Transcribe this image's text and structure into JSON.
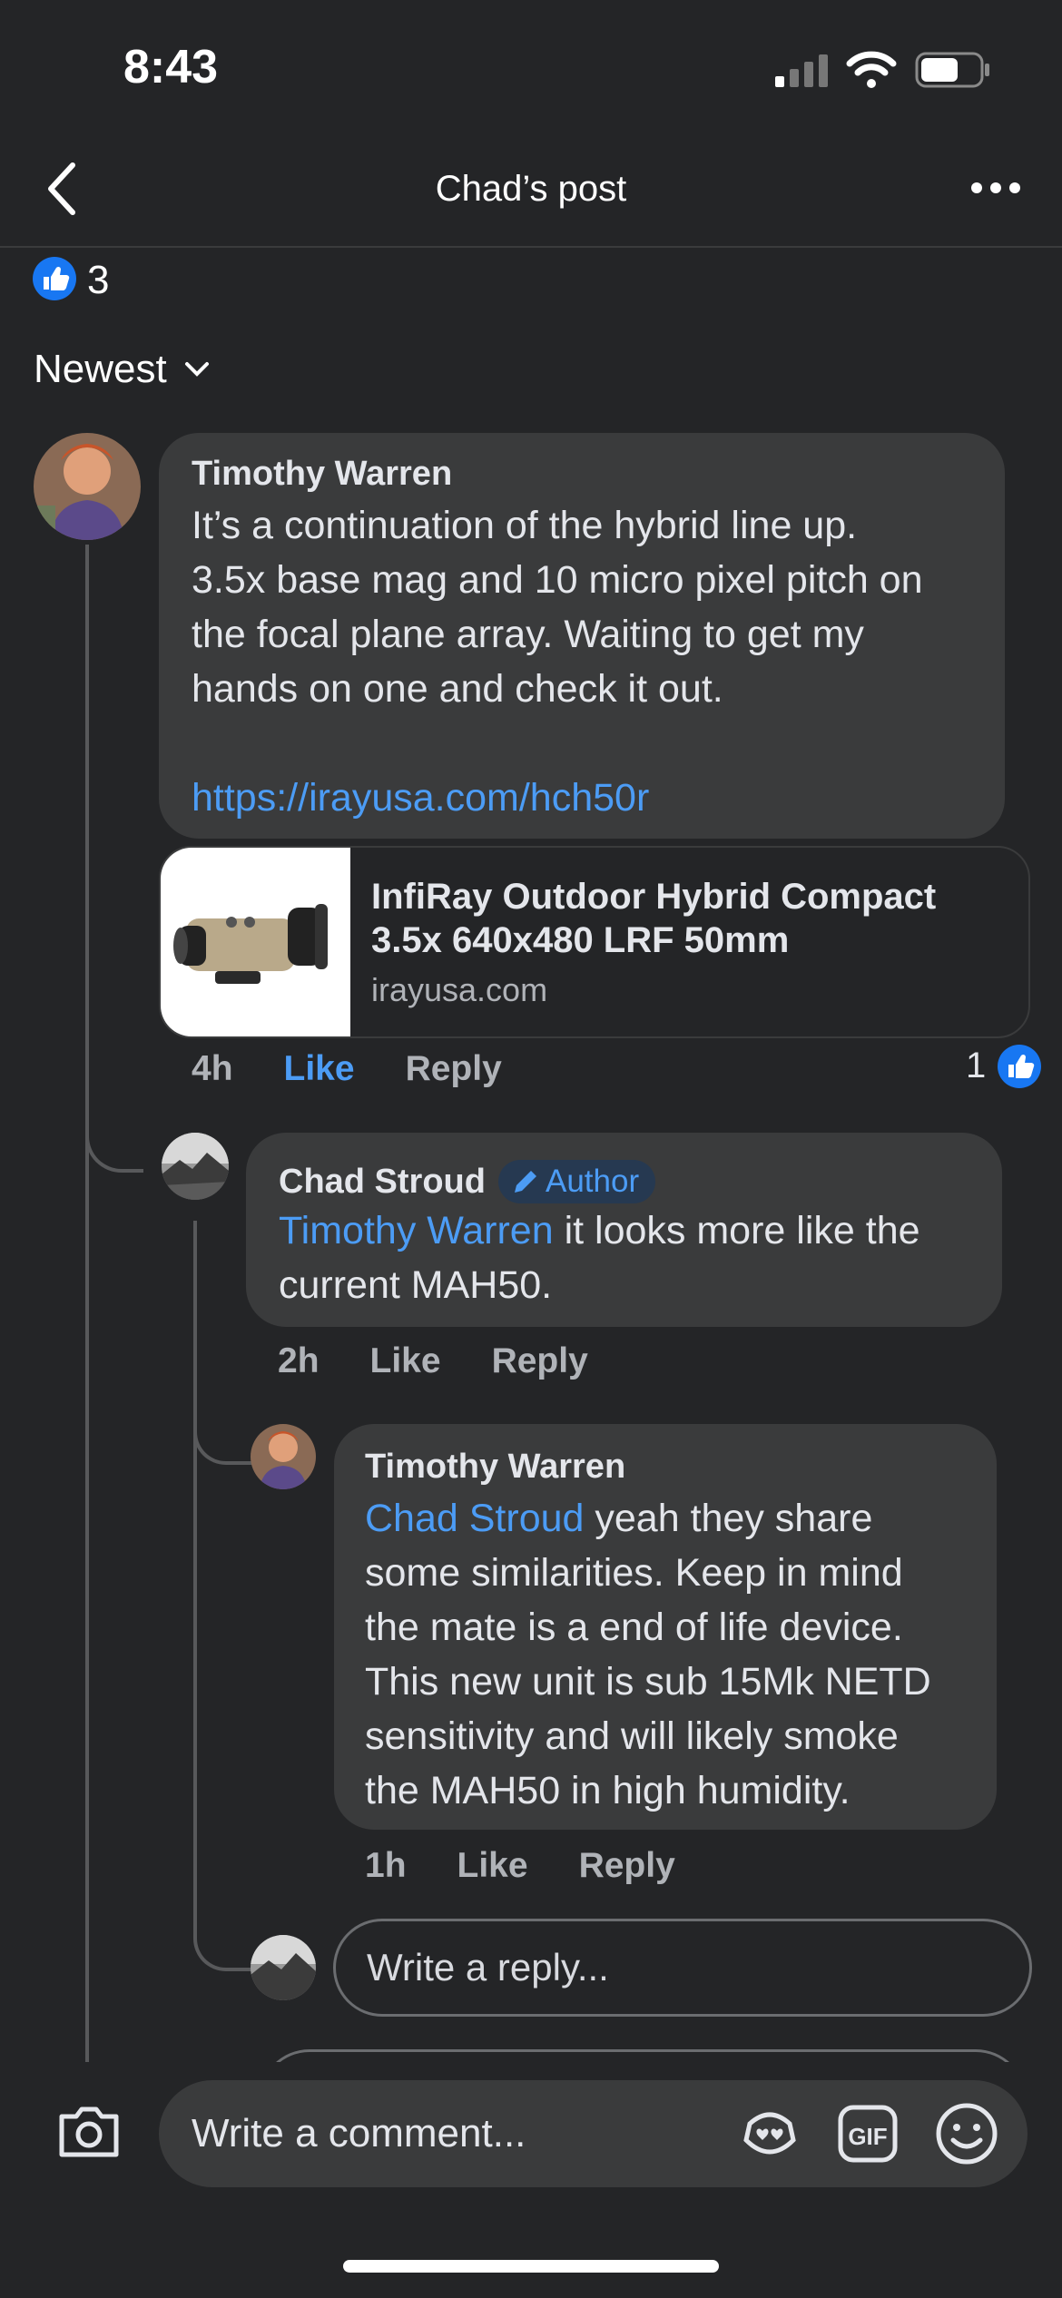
{
  "status_bar": {
    "time": "8:43"
  },
  "header": {
    "title": "Chad’s post"
  },
  "reactions": {
    "count": "3"
  },
  "sort": {
    "label": "Newest"
  },
  "comment1": {
    "author": "Timothy Warren",
    "lines": [
      "It’s a continuation of the hybrid line up.",
      "3.5x base mag and 10 micro pixel pitch on",
      "the focal plane array. Waiting to get my",
      "hands on one and check it out."
    ],
    "link": "https://irayusa.com/hch50r",
    "preview": {
      "title_line1": "InfiRay Outdoor Hybrid Compact",
      "title_line2": "3.5x 640x480 LRF 50mm",
      "domain": "irayusa.com"
    },
    "time": "4h",
    "like_label": "Like",
    "reply_label": "Reply",
    "like_count": "1"
  },
  "reply1": {
    "author": "Chad Stroud",
    "badge": "Author",
    "mention": "Timothy Warren",
    "text_line1": " it looks more like the",
    "text_line2": "current MAH50.",
    "time": "2h",
    "like_label": "Like",
    "reply_label": "Reply"
  },
  "reply2": {
    "author": "Timothy Warren",
    "mention": "Chad Stroud",
    "text_line1": " yeah they share",
    "lines": [
      "some similarities. Keep in mind",
      "the mate is a end of life device.",
      "This new unit is sub 15Mk NETD",
      "sensitivity and will likely smoke",
      "the MAH50 in high humidity."
    ],
    "time": "1h",
    "like_label": "Like",
    "reply_label": "Reply"
  },
  "reply_input": {
    "placeholder": "Write a reply..."
  },
  "comment_bar": {
    "placeholder": "Write a comment..."
  },
  "colors": {
    "accent": "#4c9cf5",
    "background": "#242527",
    "bubble": "#3a3b3c"
  }
}
